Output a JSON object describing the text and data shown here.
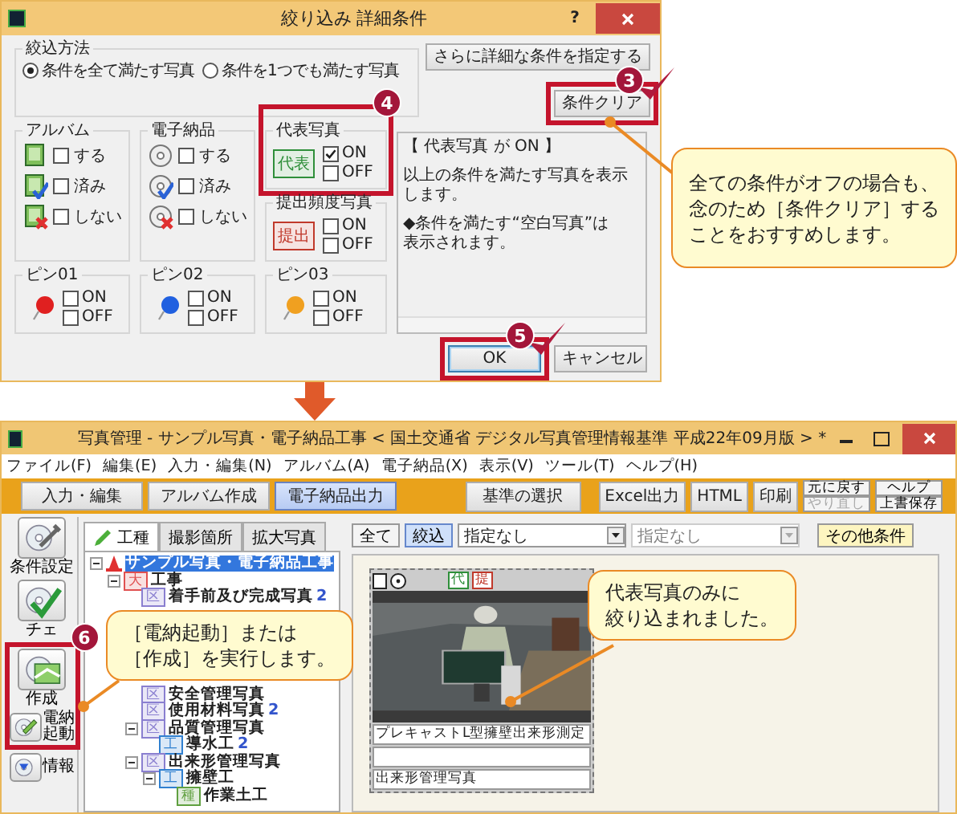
{
  "dialog": {
    "title": "絞り込み 詳細条件",
    "help": "?",
    "method": {
      "title": "絞込方法",
      "options": [
        {
          "label": "条件を全て満たす写真",
          "selected": true
        },
        {
          "label": "条件を1つでも満たす写真",
          "selected": false
        }
      ]
    },
    "detail_button": "さらに詳細な条件を指定する",
    "clear_button": {
      "label": "条件クリア",
      "step": {
        "number": "3",
        "ticked": true
      }
    },
    "groups": [
      {
        "title": "アルバム",
        "kind": "album",
        "rows": [
          {
            "label": "する",
            "checked": false
          },
          {
            "label": "済み",
            "checked": false
          },
          {
            "label": "しない",
            "checked": false
          }
        ]
      },
      {
        "title": "電子納品",
        "kind": "disc",
        "rows": [
          {
            "label": "する",
            "checked": false
          },
          {
            "label": "済み",
            "checked": false
          },
          {
            "label": "しない",
            "checked": false
          }
        ]
      },
      {
        "title": "代表写真",
        "kind": "tag",
        "tag": "代表",
        "color": "#2f8f3a",
        "step": {
          "number": "4",
          "ticked": false
        },
        "rows": [
          {
            "label": "ON",
            "checked": true
          },
          {
            "label": "OFF",
            "checked": false
          }
        ]
      },
      {
        "title": "提出頻度写真",
        "kind": "tag",
        "tag": "提出",
        "color": "#c0392b",
        "rows": [
          {
            "label": "ON",
            "checked": false
          },
          {
            "label": "OFF",
            "checked": false
          }
        ]
      },
      {
        "title": "ピン01",
        "kind": "pin",
        "color": "#e02020",
        "rows": [
          {
            "label": "ON",
            "checked": false
          },
          {
            "label": "OFF",
            "checked": false
          }
        ]
      },
      {
        "title": "ピン02",
        "kind": "pin",
        "color": "#2060e0",
        "rows": [
          {
            "label": "ON",
            "checked": false
          },
          {
            "label": "OFF",
            "checked": false
          }
        ]
      },
      {
        "title": "ピン03",
        "kind": "pin",
        "color": "#f0a020",
        "rows": [
          {
            "label": "ON",
            "checked": false
          },
          {
            "label": "OFF",
            "checked": false
          }
        ]
      }
    ],
    "info": [
      "【 代表写真 が ON 】",
      "以上の条件を満たす写真を表示します。",
      "◆条件を満たす“空白写真”は",
      "表示されます。"
    ],
    "buttons": [
      {
        "label": "OK",
        "default": true,
        "step": {
          "number": "5",
          "ticked": true
        }
      },
      {
        "label": "キャンセル",
        "default": false
      }
    ]
  },
  "callouts": [
    {
      "lines": [
        "全ての条件がオフの場合も、",
        "念のため［条件クリア］する",
        "ことをおすすめします。"
      ]
    },
    {
      "lines": [
        "代表写真のみに",
        "絞り込まれました。"
      ]
    },
    {
      "lines": [
        "［電納起動］または",
        "［作成］を実行します。"
      ]
    }
  ],
  "app": {
    "title": "写真管理 - サンプル写真・電子納品工事 < 国土交通省 デジタル写真管理情報基準 平成22年09月版 > *",
    "menu": [
      "ファイル(F)",
      "編集(E)",
      "入力・編集(N)",
      "アルバム(A)",
      "電子納品(X)",
      "表示(V)",
      "ツール(T)",
      "ヘルプ(H)"
    ],
    "modes": [
      {
        "label": "入力・編集",
        "selected": false
      },
      {
        "label": "アルバム作成",
        "selected": false
      },
      {
        "label": "電子納品出力",
        "selected": true
      }
    ],
    "actions": [
      "基準の選択",
      "Excel出力",
      "HTML",
      "印刷"
    ],
    "stacked": [
      {
        "label": "元に戻す",
        "disabled": false
      },
      {
        "label": "やり直し",
        "disabled": true
      },
      {
        "label": "ヘルプ",
        "disabled": false
      },
      {
        "label": "上書保存",
        "disabled": false
      }
    ],
    "sidebar": {
      "step": {
        "number": "6",
        "ticked": false
      },
      "items": [
        {
          "label": "条件設定",
          "kind": "settings",
          "highlighted": false
        },
        {
          "label": "チェ",
          "kind": "check",
          "highlighted": false
        },
        {
          "label": "作成",
          "kind": "create",
          "highlighted": true
        },
        {
          "label": "電納起動",
          "kind": "launch",
          "highlighted": true
        },
        {
          "label": "情報",
          "kind": "info",
          "highlighted": false
        }
      ]
    },
    "tabs": [
      {
        "label": "工種",
        "selected": true
      },
      {
        "label": "撮影箇所",
        "selected": false
      },
      {
        "label": "拡大写真",
        "selected": false
      }
    ],
    "tree": [
      {
        "label": "サンプル写真・電子納品工事",
        "selected": true,
        "expanded": true,
        "children": [
          {
            "tag": "大",
            "color": "#e05050",
            "label": "工事",
            "selected": false,
            "expanded": true,
            "children": [
              {
                "tag": "区",
                "color": "#8a7fd0",
                "label": "着手前及び完成写真",
                "count": "2",
                "selected": false
              },
              {
                "tag": "区",
                "color": "#8a7fd0",
                "label": "安全管理写真",
                "selected": false
              },
              {
                "tag": "区",
                "color": "#8a7fd0",
                "label": "使用材料写真",
                "count": "2",
                "selected": false
              },
              {
                "tag": "区",
                "color": "#8a7fd0",
                "label": "品質管理写真",
                "selected": false,
                "expanded": true,
                "children": [
                  {
                    "tag": "工",
                    "color": "#3080d0",
                    "label": "導水工",
                    "count": "2",
                    "selected": false
                  }
                ]
              },
              {
                "tag": "区",
                "color": "#8a7fd0",
                "label": "出来形管理写真",
                "selected": false,
                "expanded": true,
                "children": [
                  {
                    "tag": "工",
                    "color": "#3080d0",
                    "label": "擁壁工",
                    "selected": false,
                    "expanded": true,
                    "children": [
                      {
                        "tag": "種",
                        "color": "#60a040",
                        "label": "作業土工",
                        "selected": false
                      }
                    ]
                  }
                ]
              }
            ]
          }
        ]
      }
    ],
    "filters": {
      "buttons": [
        {
          "label": "全て",
          "selected": false
        },
        {
          "label": "絞込",
          "selected": true
        }
      ],
      "selects": [
        {
          "value": "指定なし",
          "disabled": false
        },
        {
          "value": "指定なし",
          "disabled": true
        }
      ],
      "more": "その他条件"
    },
    "photo": {
      "kind": "picture",
      "tags": [
        {
          "label": "代",
          "color": "#2f8f3a"
        },
        {
          "label": "提",
          "color": "#c0392b"
        }
      ],
      "title": "プレキャストL型擁壁出来形測定",
      "category": "出来形管理写真"
    }
  }
}
